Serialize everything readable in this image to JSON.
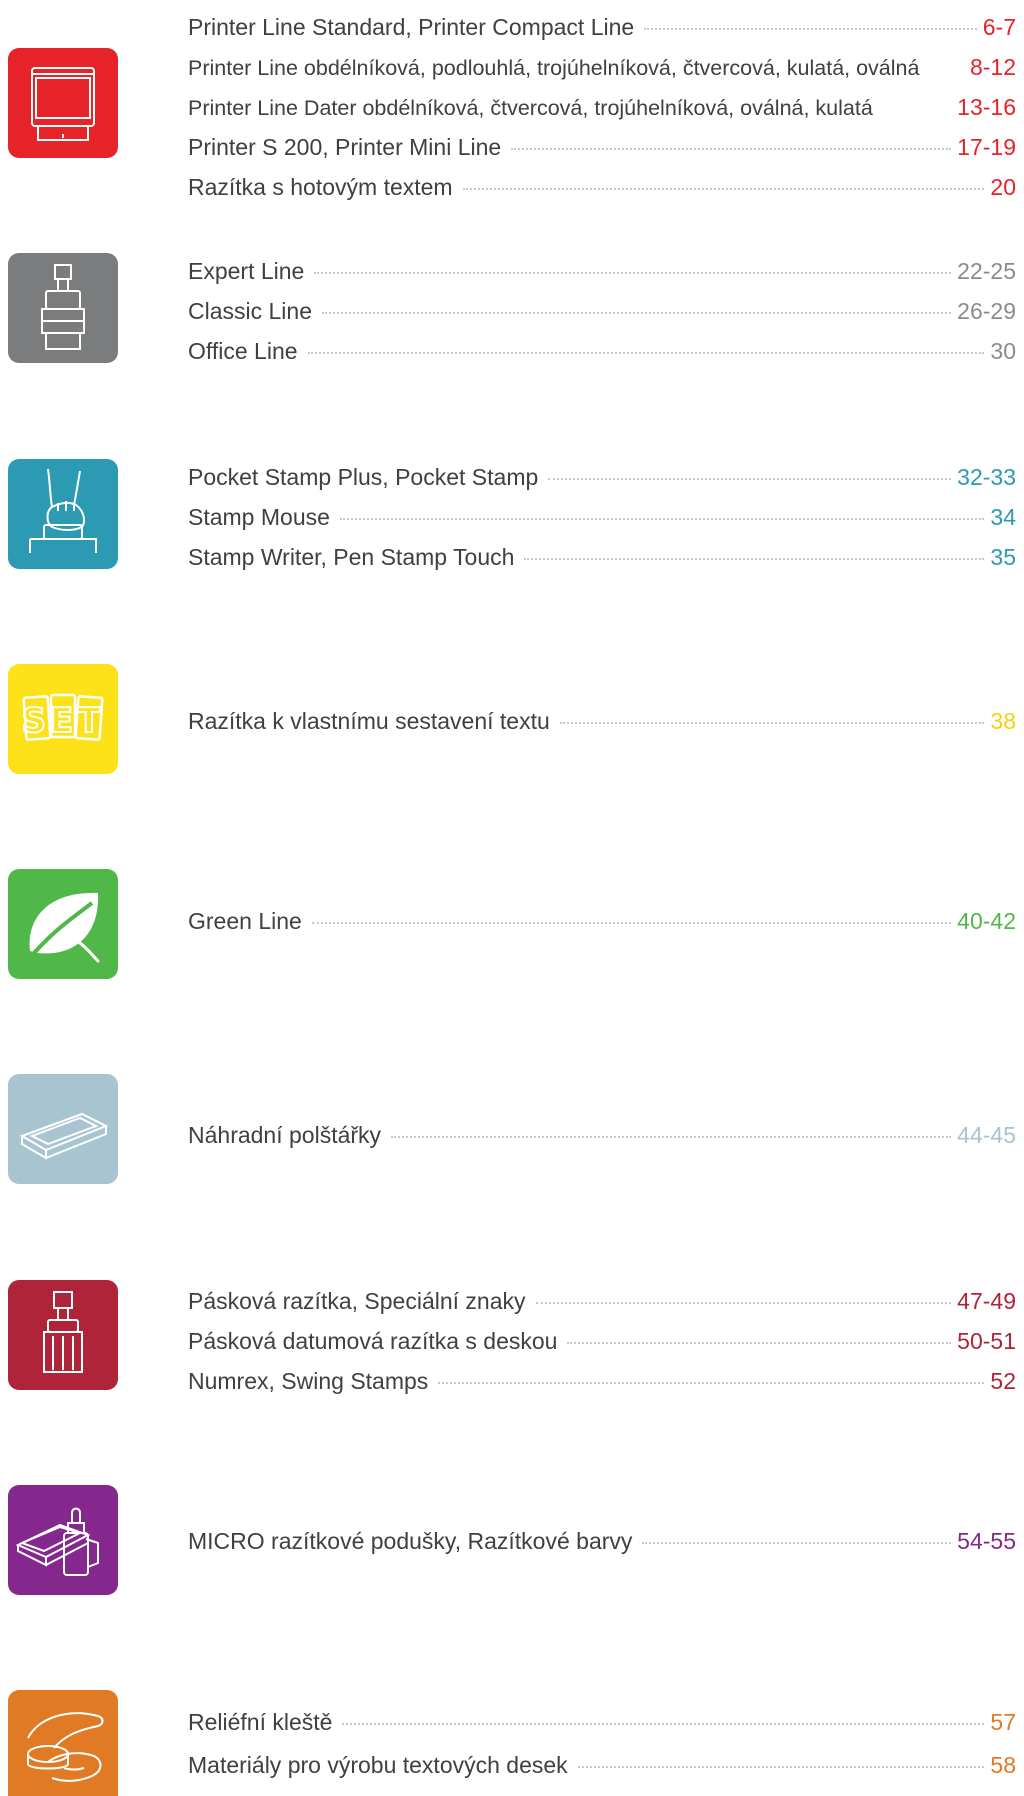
{
  "sections": [
    {
      "key": "printer",
      "icon": "self-inking-stamp-icon",
      "color": "#e52329",
      "entries": [
        {
          "label": "Printer Line Standard, Printer Compact Line",
          "page": "6-7"
        },
        {
          "label": "Printer Line obdélníková, podlouhlá, trojúhelníková, čtvercová, kulatá, oválná",
          "page": "8-12"
        },
        {
          "label": "Printer Line Dater obdélníková, čtvercová, trojúhelníková, oválná, kulatá",
          "page": "13-16"
        },
        {
          "label": "Printer S 200, Printer Mini Line",
          "page": "17-19"
        },
        {
          "label": "Razítka s hotovým textem",
          "page": "20"
        }
      ]
    },
    {
      "key": "expert",
      "icon": "metal-stamp-icon",
      "color": "#7b7c7e",
      "entries": [
        {
          "label": "Expert Line",
          "page": "22-25"
        },
        {
          "label": "Classic Line",
          "page": "26-29"
        },
        {
          "label": "Office Line",
          "page": "30"
        }
      ]
    },
    {
      "key": "pocket",
      "icon": "hand-stamp-icon",
      "color": "#2d9ab4",
      "entries": [
        {
          "label": "Pocket Stamp Plus, Pocket Stamp",
          "page": "32-33"
        },
        {
          "label": "Stamp Mouse",
          "page": "34"
        },
        {
          "label": "Stamp Writer, Pen Stamp Touch",
          "page": "35"
        }
      ]
    },
    {
      "key": "set",
      "icon": "set-icon",
      "icon_text": "SET",
      "color": "#fde21a",
      "entries": [
        {
          "label": "Razítka k vlastnímu sestavení textu",
          "page": "38"
        }
      ]
    },
    {
      "key": "green",
      "icon": "leaf-icon",
      "color": "#50b848",
      "entries": [
        {
          "label": "Green Line",
          "page": "40-42"
        }
      ]
    },
    {
      "key": "pads",
      "icon": "ink-pad-icon",
      "color": "#a9c4d1",
      "entries": [
        {
          "label": "Náhradní polštářky",
          "page": "44-45"
        }
      ]
    },
    {
      "key": "band",
      "icon": "band-stamp-icon",
      "color": "#b0243a",
      "entries": [
        {
          "label": "Pásková razítka, Speciální znaky",
          "page": "47-49"
        },
        {
          "label": "Pásková datumová razítka s deskou",
          "page": "50-51"
        },
        {
          "label": "Numrex, Swing Stamps",
          "page": "52"
        }
      ]
    },
    {
      "key": "micro",
      "icon": "stamp-pad-ink-icon",
      "color": "#85288d",
      "entries": [
        {
          "label": "MICRO razítkové podušky, Razítkové barvy",
          "page": "54-55"
        }
      ]
    },
    {
      "key": "embosser",
      "icon": "embosser-icon",
      "color": "#e07a24",
      "entries": [
        {
          "label": "Reliéfní kleště",
          "page": "57"
        },
        {
          "label": "Materiály pro výrobu textových desek",
          "page": "58"
        }
      ]
    }
  ]
}
